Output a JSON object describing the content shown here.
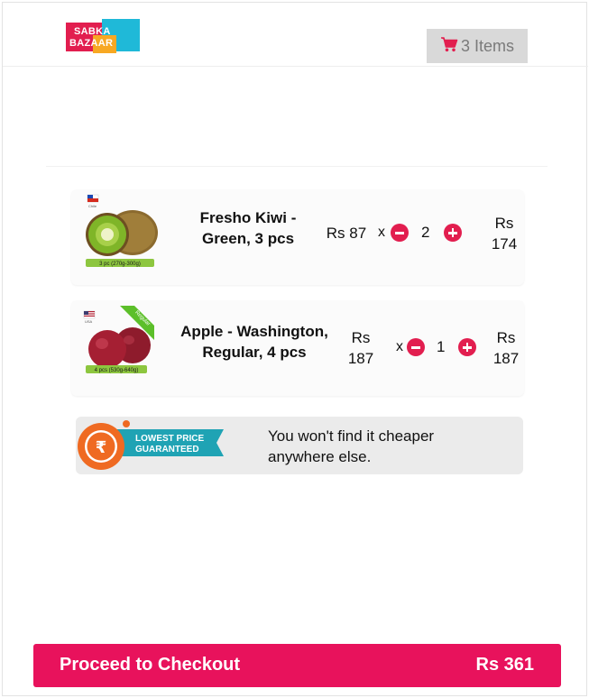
{
  "header": {
    "logo_line1": "SABKA",
    "logo_line2": "BAZAAR",
    "cart_label": "3 Items"
  },
  "cart": {
    "items": [
      {
        "name_line1": "Fresho Kiwi -",
        "name_line2": "Green, 3 pcs",
        "unit_price": "Rs 87",
        "times": "x",
        "quantity": "2",
        "total_line1": "Rs",
        "total_line2": "174",
        "pack_label": "3 pc (270g-300g)",
        "origin_label": "Chile"
      },
      {
        "name_line1": "Apple - Washington,",
        "name_line2": "Regular, 4 pcs",
        "unit_price_line1": "Rs",
        "unit_price_line2": "187",
        "times": "x",
        "quantity": "1",
        "total_line1": "Rs",
        "total_line2": "187",
        "pack_label": "4 pcs (530g-640g)",
        "origin_label": "USA",
        "ribbon_label": "Regular"
      }
    ]
  },
  "promo": {
    "badge_line1": "LOWEST PRICE",
    "badge_line2": "GUARANTEED",
    "text_line1": "You won't find it cheaper",
    "text_line2": "anywhere else."
  },
  "checkout": {
    "label": "Proceed to Checkout",
    "total": "Rs 361"
  },
  "colors": {
    "accent": "#e8125c",
    "icon_pink": "#e21e4f",
    "cart_button_bg": "#d9d9d9"
  },
  "icons": [
    "cart-icon",
    "minus-icon",
    "plus-icon",
    "rupee-icon"
  ]
}
